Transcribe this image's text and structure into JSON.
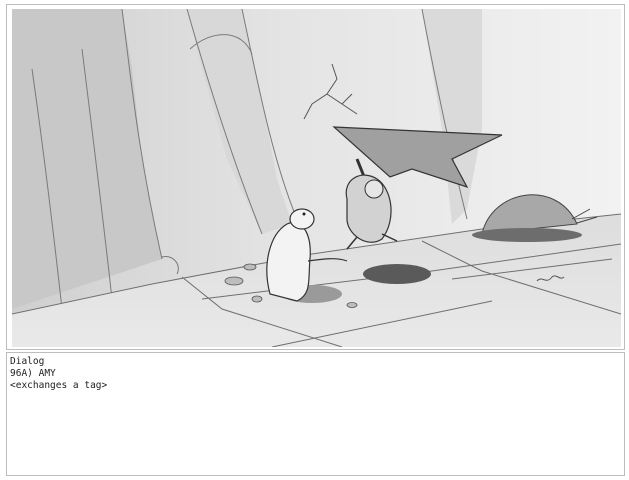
{
  "dialog": {
    "heading": "Dialog",
    "lines": [
      "96A) AMY",
      "<exchanges a tag>"
    ]
  }
}
